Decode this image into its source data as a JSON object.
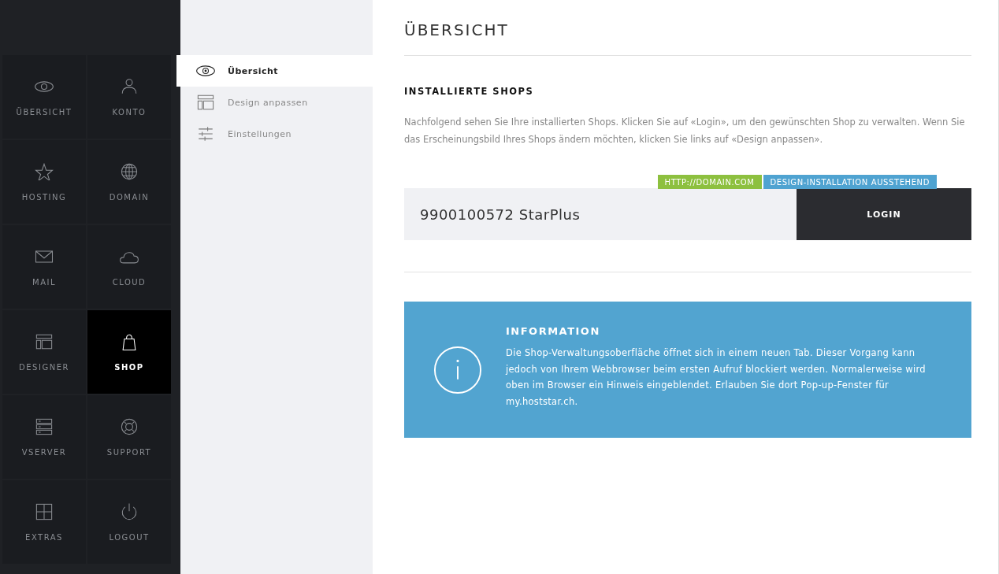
{
  "main_nav": [
    {
      "label": "ÜBERSICHT",
      "kind": "eye",
      "selected": false
    },
    {
      "label": "KONTO",
      "kind": "person",
      "selected": false
    },
    {
      "label": "HOSTING",
      "kind": "star",
      "selected": false
    },
    {
      "label": "DOMAIN",
      "kind": "globe",
      "selected": false
    },
    {
      "label": "MAIL",
      "kind": "envelope",
      "selected": false
    },
    {
      "label": "CLOUD",
      "kind": "cloud",
      "selected": false
    },
    {
      "label": "DESIGNER",
      "kind": "layout",
      "selected": false
    },
    {
      "label": "SHOP",
      "kind": "bag",
      "selected": true
    },
    {
      "label": "VSERVER",
      "kind": "server",
      "selected": false
    },
    {
      "label": "SUPPORT",
      "kind": "lifebuoy",
      "selected": false
    },
    {
      "label": "EXTRAS",
      "kind": "plus",
      "selected": false
    },
    {
      "label": "LOGOUT",
      "kind": "power",
      "selected": false
    }
  ],
  "sub_nav": [
    {
      "label": "Übersicht",
      "kind": "eye",
      "selected": true
    },
    {
      "label": "Design anpassen",
      "kind": "layout",
      "selected": false
    },
    {
      "label": "Einstellungen",
      "kind": "sliders",
      "selected": false
    }
  ],
  "page_title": "ÜBERSICHT",
  "section": {
    "title": "INSTALLIERTE SHOPS",
    "description": "Nachfolgend sehen Sie Ihre installierten Shops. Klicken Sie auf «Login», um den gewünschten Shop zu verwalten. Wenn Sie das Erscheinungsbild Ihres Shops ändern möchten, klicken Sie links auf «Design anpassen»."
  },
  "shops": [
    {
      "name": "9900100572 StarPlus",
      "tags": [
        {
          "label": "HTTP://DOMAIN.COM",
          "color": "#8dc03f"
        },
        {
          "label": "DESIGN-INSTALLATION AUSSTEHEND",
          "color": "#4fa3d1"
        }
      ],
      "button": "LOGIN"
    }
  ],
  "info": {
    "title": "INFORMATION",
    "text": "Die Shop-Verwaltungsoberfläche öffnet sich in einem neuen Tab. Dieser Vorgang kann jedoch von Ihrem Webbrowser beim ersten Aufruf blockiert werden. Normalerweise wird oben im Browser ein Hinweis eingeblendet. Erlauben Sie dort Pop-up-Fenster für my.hoststar.ch."
  }
}
